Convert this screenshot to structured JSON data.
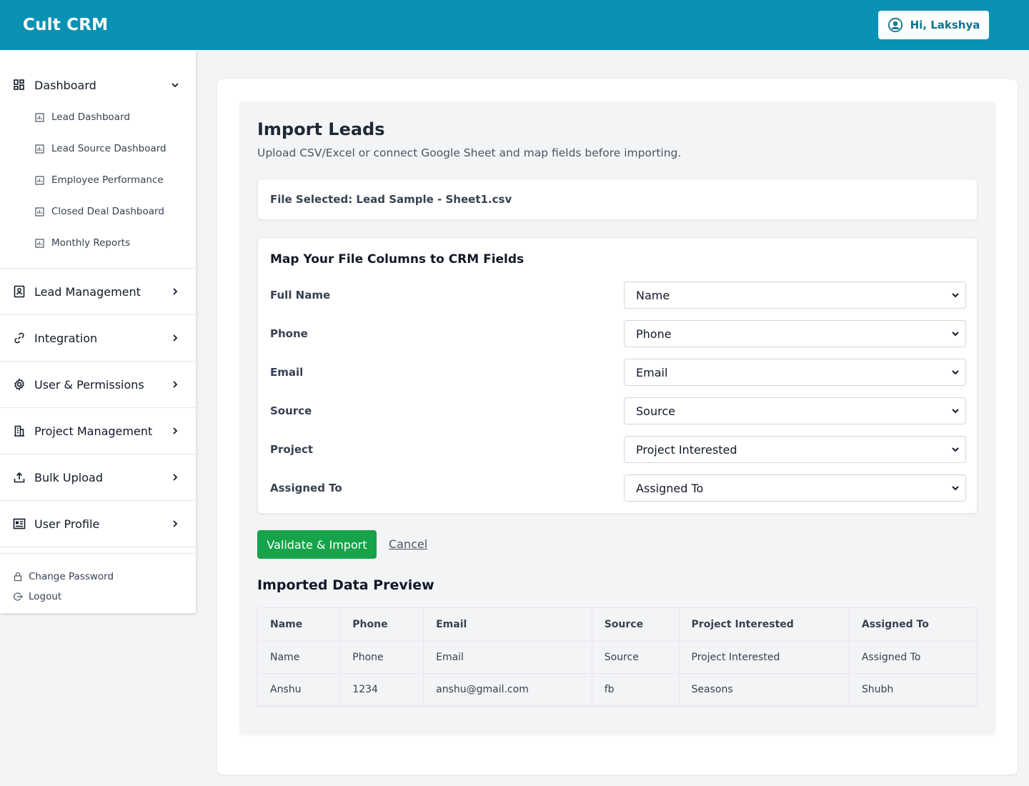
{
  "app": {
    "title": "Cult CRM"
  },
  "header": {
    "greeting": "Hi, Lakshya"
  },
  "sidebar": {
    "dashboard": {
      "label": "Dashboard",
      "items": [
        {
          "label": "Lead Dashboard"
        },
        {
          "label": "Lead Source Dashboard"
        },
        {
          "label": "Employee Performance"
        },
        {
          "label": "Closed Deal Dashboard"
        },
        {
          "label": "Monthly Reports"
        }
      ]
    },
    "sections": [
      {
        "label": "Lead Management",
        "icon": "contact-book-icon"
      },
      {
        "label": "Integration",
        "icon": "link-icon"
      },
      {
        "label": "User & Permissions",
        "icon": "gear-icon"
      },
      {
        "label": "Project Management",
        "icon": "building-icon"
      },
      {
        "label": "Bulk Upload",
        "icon": "upload-icon"
      },
      {
        "label": "User Profile",
        "icon": "profile-card-icon"
      }
    ],
    "footer": {
      "change_password": "Change Password",
      "logout": "Logout"
    }
  },
  "main": {
    "title": "Import Leads",
    "subtitle": "Upload CSV/Excel or connect Google Sheet and map fields before importing.",
    "file_selected": "File Selected: Lead Sample - Sheet1.csv",
    "mapping": {
      "title": "Map Your File Columns to CRM Fields",
      "rows": [
        {
          "field": "Full Name",
          "value": "Name"
        },
        {
          "field": "Phone",
          "value": "Phone"
        },
        {
          "field": "Email",
          "value": "Email"
        },
        {
          "field": "Source",
          "value": "Source"
        },
        {
          "field": "Project",
          "value": "Project Interested"
        },
        {
          "field": "Assigned To",
          "value": "Assigned To"
        }
      ]
    },
    "actions": {
      "validate": "Validate & Import",
      "cancel": "Cancel"
    },
    "preview": {
      "title": "Imported Data Preview",
      "columns": [
        "Name",
        "Phone",
        "Email",
        "Source",
        "Project Interested",
        "Assigned To"
      ],
      "rows": [
        [
          "Name",
          "Phone",
          "Email",
          "Source",
          "Project Interested",
          "Assigned To"
        ],
        [
          "Anshu",
          "1234",
          "anshu@gmail.com",
          "fb",
          "Seasons",
          "Shubh"
        ]
      ]
    }
  },
  "colors": {
    "brand": "#0891b2",
    "success": "#16a34a"
  }
}
